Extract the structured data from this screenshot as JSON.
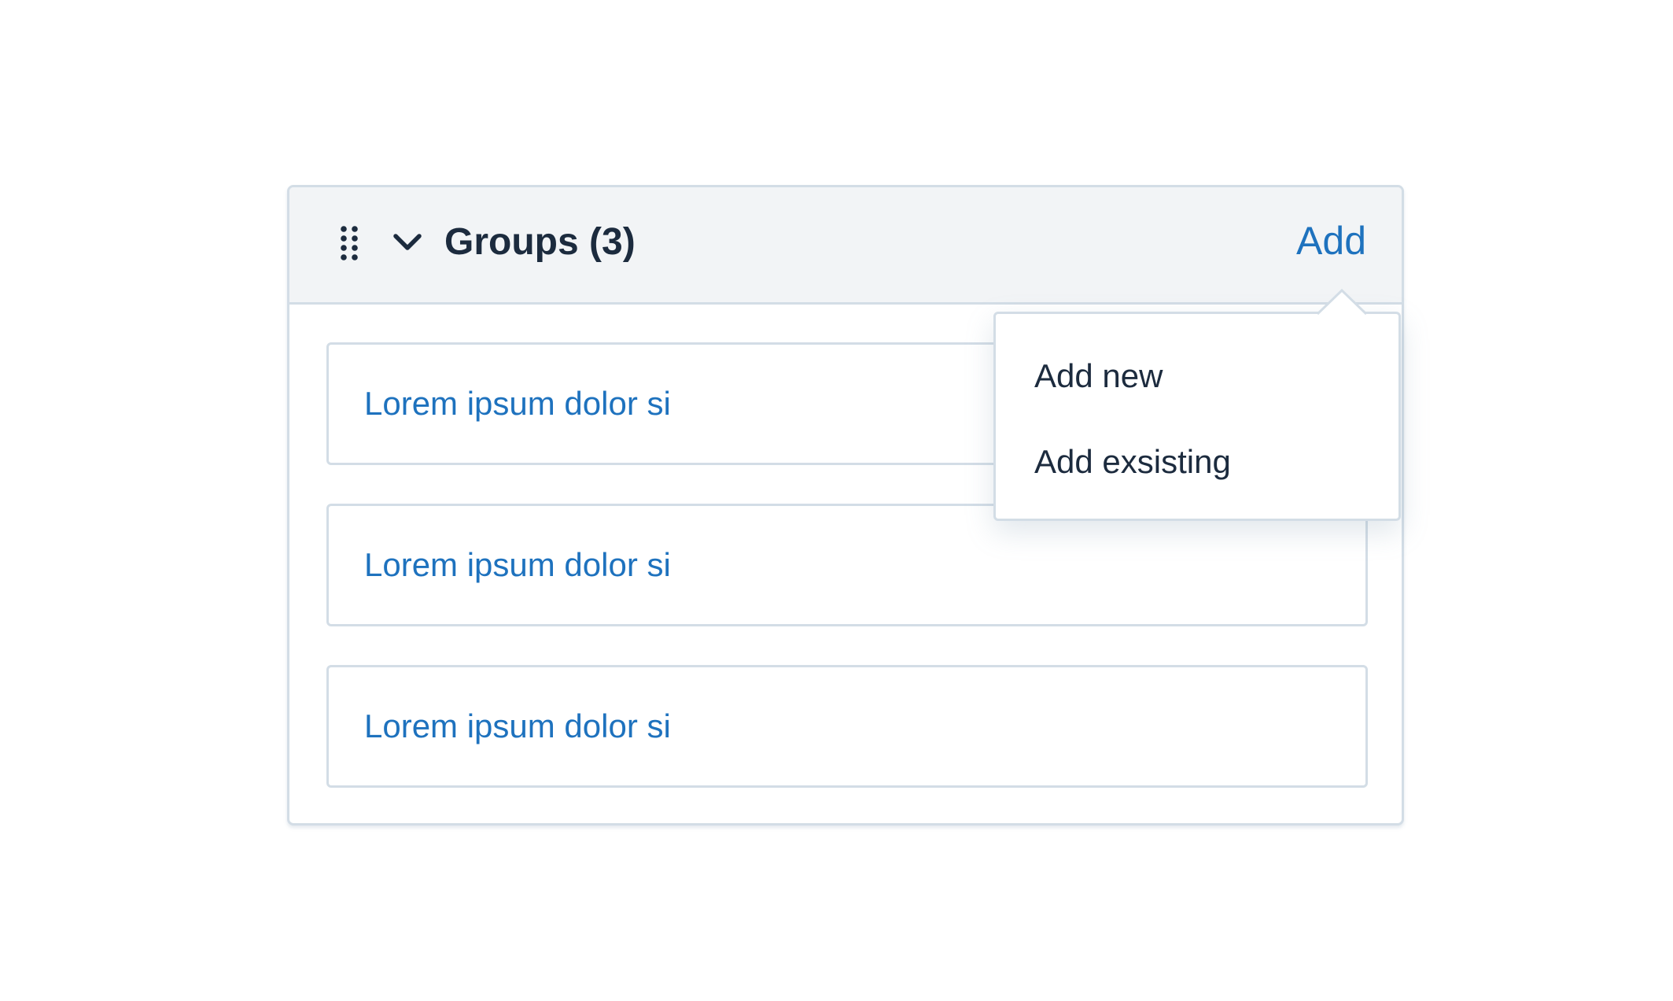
{
  "group": {
    "title": "Groups (3)",
    "add_label": "Add"
  },
  "items": [
    {
      "label": "Lorem ipsum dolor si"
    },
    {
      "label": "Lorem ipsum dolor si"
    },
    {
      "label": "Lorem ipsum dolor si"
    }
  ],
  "add_menu": {
    "options": [
      {
        "label": "Add new"
      },
      {
        "label": "Add exsisting"
      }
    ]
  },
  "icons": {
    "drag_handle": "drag-handle-icon",
    "collapse": "chevron-down-icon"
  },
  "colors": {
    "link": "#1e72be",
    "text": "#1c2b3e",
    "border": "#d3dde6",
    "header_background": "#f2f4f6"
  }
}
